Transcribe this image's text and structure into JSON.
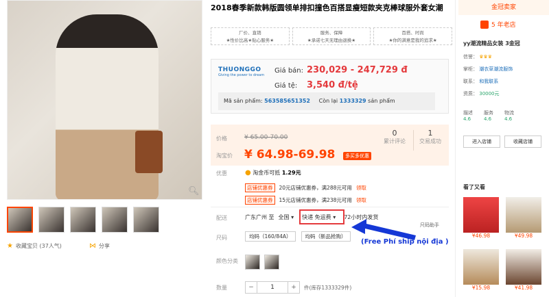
{
  "product": {
    "title": "2018春季新款韩版圆领单排扣撞色百搭显瘦短款夹克棒球服外套女潮",
    "promises": [
      {
        "head": "厂价、直销",
        "body": "★性价比高★贴心服务★"
      },
      {
        "head": "服务、保障",
        "body": "★承诺七天无理由退换★"
      },
      {
        "head": "百搭、时尚",
        "body": "★你的满意是我的追求★"
      }
    ]
  },
  "gallery": {
    "favorite_label": "收藏宝贝 (37人气)",
    "share_label": "分享",
    "zoom_icon": "magnifier-icon"
  },
  "thuonggo": {
    "logo_text": "THUONGGO",
    "logo_sub": "Giving the power to dream",
    "price_label": "Giá bán:",
    "price_value": "230,029 - 247,729 đ",
    "rate_label": "Giá tệ:",
    "rate_value": "3,540 đ/tệ",
    "code_label": "Mã sản phẩm:",
    "code_value": "563585651352",
    "stock_label": "Còn lại",
    "stock_value": "1333329",
    "stock_unit": "sản phẩm"
  },
  "taobao": {
    "price_label": "价格",
    "old_price": "¥ 65.00-70.00",
    "promo_label": "淘宝价",
    "new_price": "¥ 64.98-69.98",
    "promo_badge": "多买多优惠",
    "reviews_count": "0",
    "reviews_label": "累计评论",
    "sales_count": "1",
    "sales_label": "交易成功",
    "benefit_label": "优惠",
    "coin_text": "淘金币可抵",
    "coin_value": "1.29元",
    "coupons": [
      {
        "tag": "店铺优惠券",
        "text": "20元店铺优惠券，满288元可用",
        "link": "领取"
      },
      {
        "tag": "店铺优惠券",
        "text": "15元店铺优惠券，满238元可用",
        "link": "领取"
      }
    ],
    "shipping_label": "配送",
    "ship_from": "广东广州 至",
    "ship_to": "全国",
    "ship_method": "快递 免运费",
    "ship_time": "72小时内发货",
    "size_helper": "尺码助手",
    "size_label": "尺码",
    "sizes": [
      "均码（160/84A）",
      "均码（新品抢购）"
    ],
    "color_label": "颜色分类",
    "qty_label": "数量",
    "qty_value": "1",
    "qty_stock": "件(库存1333329件)",
    "annotation": "(Free Phí ship nội địa )"
  },
  "seller": {
    "header": "金冠卖家",
    "years": "5 年老店",
    "shop_name": "yy潮流精品女装 3金冠",
    "credit_label": "信誉：",
    "owner_label": "掌柜：",
    "owner": "潮衣草潮流服饰",
    "contact_label": "联系：",
    "contact": "和我联系",
    "deposit_label": "资质：",
    "deposit": "30000元",
    "rates": [
      {
        "label": "描述",
        "value": "4.6"
      },
      {
        "label": "服务",
        "value": "4.6"
      },
      {
        "label": "物流",
        "value": "4.6"
      }
    ],
    "enter_shop": "进入店铺",
    "fav_shop": "收藏店铺",
    "also_title": "看了又看",
    "also": [
      {
        "price": "¥46.98"
      },
      {
        "price": "¥49.98"
      },
      {
        "price": "¥15.98"
      },
      {
        "price": "¥41.98"
      }
    ]
  },
  "colors": {
    "accent": "#ff4400",
    "price_red": "#e4393c",
    "link_blue": "#1e6fb9",
    "annotation_blue": "#1538d6"
  }
}
